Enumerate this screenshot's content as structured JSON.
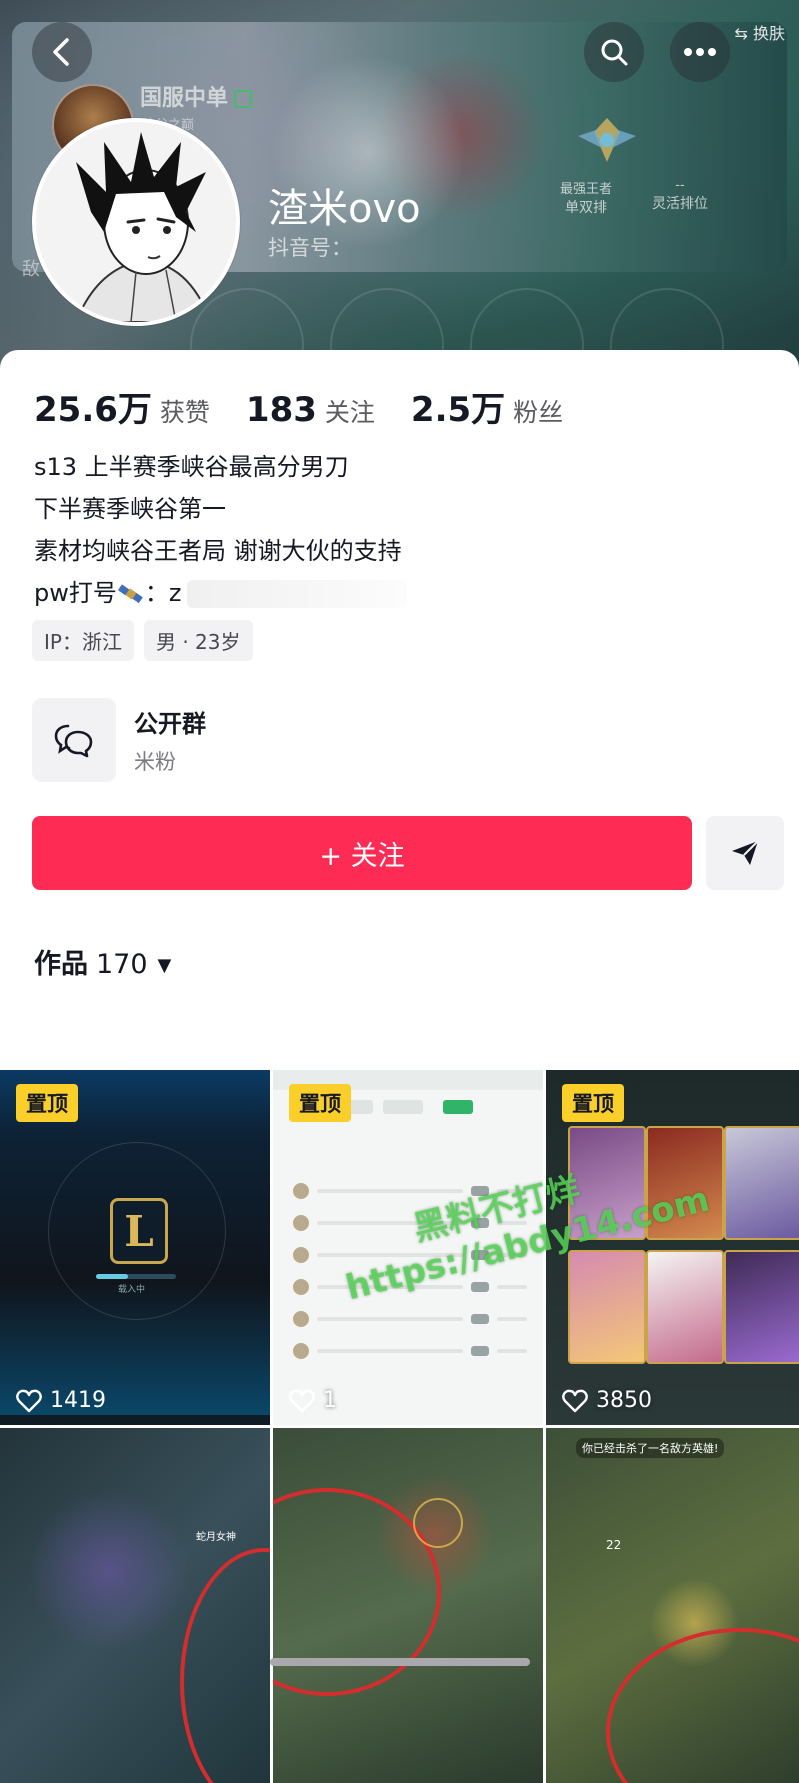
{
  "header": {
    "banner_title": "国服中单",
    "banner_subtitle": "峡谷之巅",
    "rank_solo_top": "最强王者",
    "rank_solo_label": "单双排",
    "rank_flex_top": "--",
    "rank_flex_label": "灵活排位",
    "skin_label": "换肤",
    "nickname": "渣米ovo",
    "douyin_id_label": "抖音号：",
    "faint_left": "敌"
  },
  "stats": {
    "likes_num": "25.6万",
    "likes_label": "获赞",
    "following_num": "183",
    "following_label": "关注",
    "followers_num": "2.5万",
    "followers_label": "粉丝"
  },
  "bio": {
    "line1": "s13 上半赛季峡谷最高分男刀",
    "line2": "下半赛季峡谷第一",
    "line3": "素材均峡谷王者局 谢谢大伙的支持",
    "line4_prefix": "pw打号",
    "line4_suffix": "：z"
  },
  "tags": {
    "ip": "IP：浙江",
    "gender_age": "男 · 23岁"
  },
  "group": {
    "title": "公开群",
    "subtitle": "米粉"
  },
  "actions": {
    "follow_label": "+ 关注"
  },
  "works": {
    "label": "作品",
    "count": "170"
  },
  "tiles": [
    {
      "pinned": "置顶",
      "likes": "1419"
    },
    {
      "pinned": "置顶",
      "likes": "1"
    },
    {
      "pinned": "置顶",
      "likes": "3850"
    }
  ],
  "tile_text": {
    "lol_loading": "载入中",
    "tile4_label": "蛇月女神",
    "tile6_banner": "你已经击杀了一名敌方英雄!",
    "tile6_num": "22"
  },
  "watermark": {
    "line1": "黑料不打烊",
    "line2": "https://abdy14.com"
  },
  "colors": {
    "primary": "#fe2c55",
    "pin": "#facf2a",
    "text": "#161823",
    "secondary_text": "#5a5b61"
  }
}
